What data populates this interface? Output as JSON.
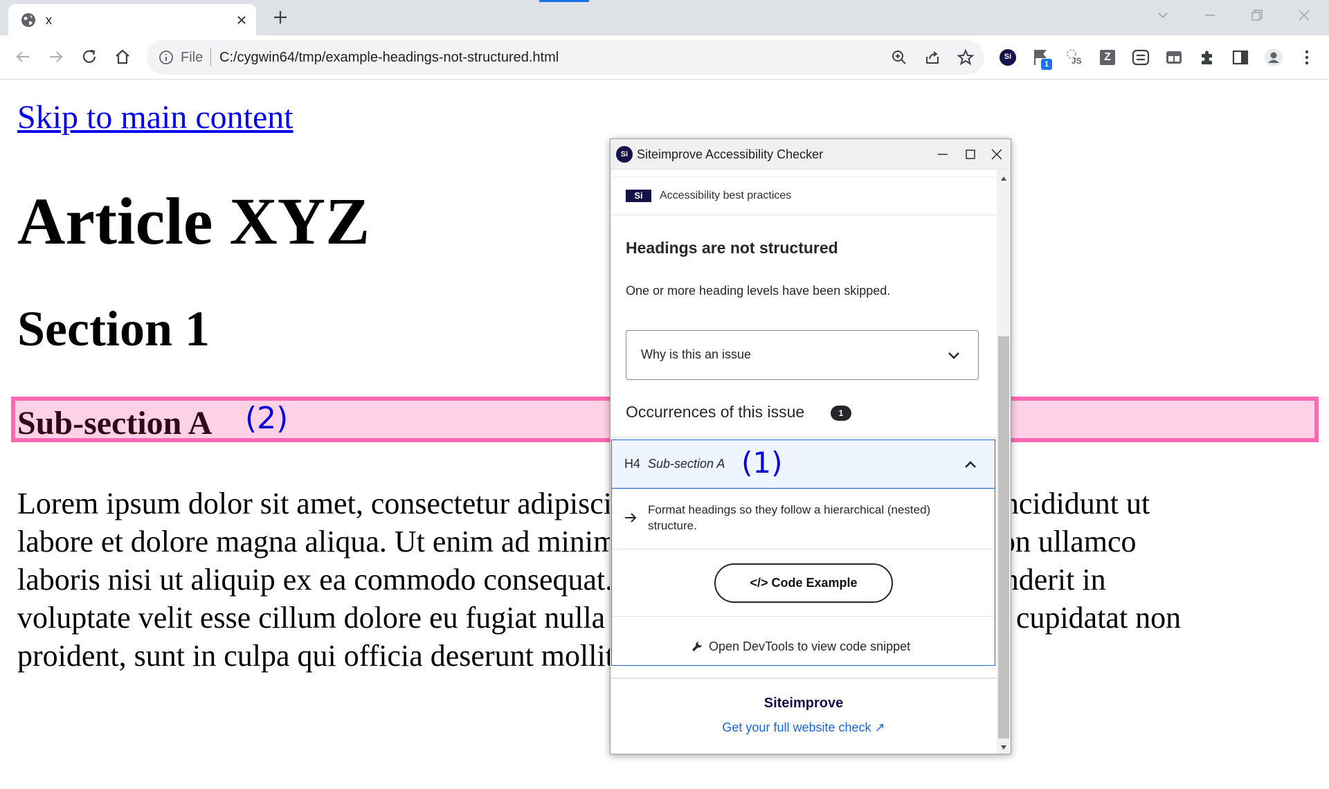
{
  "browser": {
    "tab_title": "x",
    "omnibox": {
      "scheme_label": "File",
      "url": "C:/cygwin64/tmp/example-headings-not-structured.html"
    },
    "extension_badge_count": "1",
    "ext_z_label": "Z",
    "ext_si_label": "Si",
    "ext_js_label": "JS"
  },
  "page": {
    "skip_link": "Skip to main content",
    "h1": "Article XYZ",
    "h2": "Section 1",
    "h4": "Sub-section A",
    "annotation_2": "(2)",
    "paragraph_lines": [
      "Lorem ipsum dolor sit amet, consectetur adipiscing elit, sed do eiusmod tempor incididunt ut",
      "labore et dolore magna aliqua. Ut enim ad minim veniam, quis nostrud exercitation ullamco",
      "laboris nisi ut aliquip ex ea commodo consequat. Duis aute irure dolor in reprehenderit in",
      "voluptate velit esse cillum dolore eu fugiat nulla pariatur. Excepteur sint occaecat cupidatat non",
      "proident, sunt in culpa qui officia deserunt mollit anim id est laborum."
    ]
  },
  "popup": {
    "window_title": "Siteimprove Accessibility Checker",
    "logo_label": "Si",
    "category_badge": "Si",
    "category": "Accessibility best practices",
    "issue_title": "Headings are not structured",
    "issue_description": "One or more heading levels have been skipped.",
    "why_label": "Why is this an issue",
    "occurrences_label": "Occurrences of this issue",
    "occurrences_count": "1",
    "occurrence": {
      "tag": "H4",
      "name": "Sub-section A",
      "annotation_1": "(1)"
    },
    "guidance": "Format headings so they follow a hierarchical (nested) structure.",
    "code_button": "</> Code Example",
    "devtools_text": "Open DevTools to view code snippet",
    "brand": "Siteimprove",
    "cta": "Get your full website check ↗"
  },
  "colors": {
    "highlight_border": "#ff69b4",
    "highlight_fill": "#ffd1e6",
    "brand_navy": "#15124a",
    "link_blue": "#1a66d6",
    "annotation_blue": "#0000dd"
  }
}
